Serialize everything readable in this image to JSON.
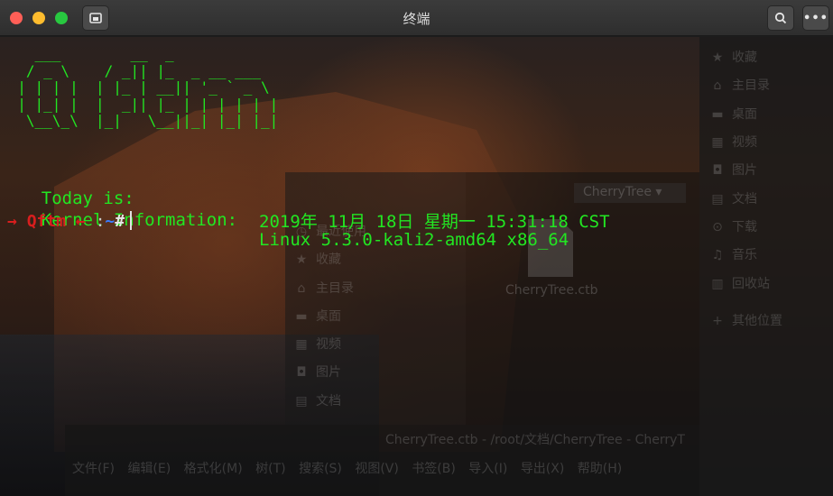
{
  "window": {
    "title": "终端"
  },
  "titlebar": {
    "new_tab_icon": "terminal-tab-icon",
    "search_icon": "⌕",
    "menu_icon": "•••"
  },
  "terminal": {
    "ascii_art": "    ___        __  _\n   / _ \\    / _|| |_  _ __ ___\n  | | | |  | |_ | __|| '_ ` _ \\\n  | |_| |  |  _|| |_ | | | | | |\n   \\__\\_\\  |_|   \\__||_| |_| |_|",
    "today_label": "Today is:",
    "today_value": "2019年 11月 18日 星期一 15:31:18 CST",
    "kernel_label": "Kernel Information:",
    "kernel_value": "Linux 5.3.0-kali2-amd64 x86_64",
    "prompt": {
      "arrow_left": "→",
      "user": "Qftm",
      "arrow_right": "←",
      "sep": " :",
      "path": "~",
      "symbol": "#"
    }
  },
  "background_file_manager": {
    "right_sidebar": [
      "收藏",
      "主目录",
      "桌面",
      "视频",
      "图片",
      "文档",
      "下载",
      "音乐",
      "回收站",
      "其他位置"
    ],
    "left_sidebar": [
      "最近使用",
      "收藏",
      "主目录",
      "桌面",
      "视频",
      "图片",
      "文档"
    ],
    "path_button": "CherryTree",
    "file_name": "CherryTree.ctb"
  },
  "background_cherrytree": {
    "title": "CherryTree.ctb - /root/文档/CherryTree - CherryT",
    "menu": [
      "文件(F)",
      "编辑(E)",
      "格式化(M)",
      "树(T)",
      "搜索(S)",
      "视图(V)",
      "书签(B)",
      "导入(I)",
      "导出(X)",
      "帮助(H)"
    ]
  },
  "colors": {
    "terminal_green": "#22e622",
    "prompt_red": "#d81e1e",
    "path_blue": "#3b7cff"
  }
}
